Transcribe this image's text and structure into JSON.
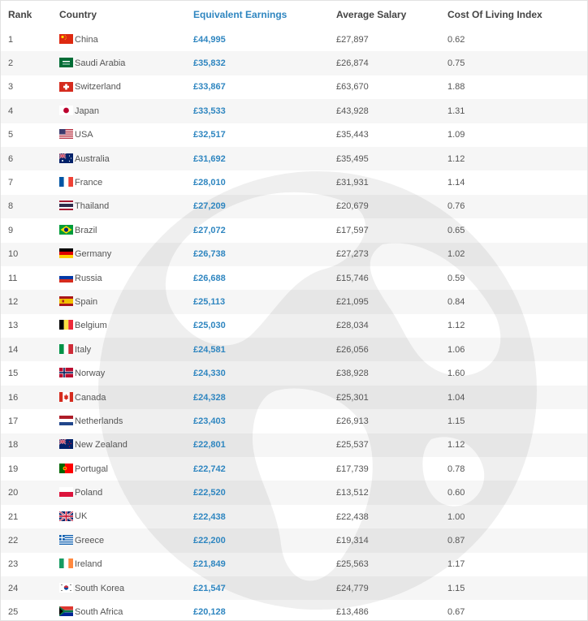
{
  "columns": {
    "rank": "Rank",
    "country": "Country",
    "equivalent_earnings": "Equivalent Earnings",
    "average_salary": "Average Salary",
    "cost_of_living_index": "Cost Of Living Index"
  },
  "accent_color": "#2f86c0",
  "rows": [
    {
      "rank": "1",
      "country": "China",
      "flag": "flag-china-icon",
      "earnings": "£44,995",
      "salary": "£27,897",
      "index": "0.62"
    },
    {
      "rank": "2",
      "country": "Saudi Arabia",
      "flag": "flag-saudi-arabia-icon",
      "earnings": "£35,832",
      "salary": "£26,874",
      "index": "0.75"
    },
    {
      "rank": "3",
      "country": "Switzerland",
      "flag": "flag-switzerland-icon",
      "earnings": "£33,867",
      "salary": "£63,670",
      "index": "1.88"
    },
    {
      "rank": "4",
      "country": "Japan",
      "flag": "flag-japan-icon",
      "earnings": "£33,533",
      "salary": "£43,928",
      "index": "1.31"
    },
    {
      "rank": "5",
      "country": "USA",
      "flag": "flag-usa-icon",
      "earnings": "£32,517",
      "salary": "£35,443",
      "index": "1.09"
    },
    {
      "rank": "6",
      "country": "Australia",
      "flag": "flag-australia-icon",
      "earnings": "£31,692",
      "salary": "£35,495",
      "index": "1.12"
    },
    {
      "rank": "7",
      "country": "France",
      "flag": "flag-france-icon",
      "earnings": "£28,010",
      "salary": "£31,931",
      "index": "1.14"
    },
    {
      "rank": "8",
      "country": "Thailand",
      "flag": "flag-thailand-icon",
      "earnings": "£27,209",
      "salary": "£20,679",
      "index": "0.76"
    },
    {
      "rank": "9",
      "country": "Brazil",
      "flag": "flag-brazil-icon",
      "earnings": "£27,072",
      "salary": "£17,597",
      "index": "0.65"
    },
    {
      "rank": "10",
      "country": "Germany",
      "flag": "flag-germany-icon",
      "earnings": "£26,738",
      "salary": "£27,273",
      "index": "1.02"
    },
    {
      "rank": "11",
      "country": "Russia",
      "flag": "flag-russia-icon",
      "earnings": "£26,688",
      "salary": "£15,746",
      "index": "0.59"
    },
    {
      "rank": "12",
      "country": "Spain",
      "flag": "flag-spain-icon",
      "earnings": "£25,113",
      "salary": "£21,095",
      "index": "0.84"
    },
    {
      "rank": "13",
      "country": "Belgium",
      "flag": "flag-belgium-icon",
      "earnings": "£25,030",
      "salary": "£28,034",
      "index": "1.12"
    },
    {
      "rank": "14",
      "country": "Italy",
      "flag": "flag-italy-icon",
      "earnings": "£24,581",
      "salary": "£26,056",
      "index": "1.06"
    },
    {
      "rank": "15",
      "country": "Norway",
      "flag": "flag-norway-icon",
      "earnings": "£24,330",
      "salary": "£38,928",
      "index": "1.60"
    },
    {
      "rank": "16",
      "country": "Canada",
      "flag": "flag-canada-icon",
      "earnings": "£24,328",
      "salary": "£25,301",
      "index": "1.04"
    },
    {
      "rank": "17",
      "country": "Netherlands",
      "flag": "flag-netherlands-icon",
      "earnings": "£23,403",
      "salary": "£26,913",
      "index": "1.15"
    },
    {
      "rank": "18",
      "country": "New Zealand",
      "flag": "flag-new-zealand-icon",
      "earnings": "£22,801",
      "salary": "£25,537",
      "index": "1.12"
    },
    {
      "rank": "19",
      "country": "Portugal",
      "flag": "flag-portugal-icon",
      "earnings": "£22,742",
      "salary": "£17,739",
      "index": "0.78"
    },
    {
      "rank": "20",
      "country": "Poland",
      "flag": "flag-poland-icon",
      "earnings": "£22,520",
      "salary": "£13,512",
      "index": "0.60"
    },
    {
      "rank": "21",
      "country": "UK",
      "flag": "flag-uk-icon",
      "earnings": "£22,438",
      "salary": "£22,438",
      "index": "1.00"
    },
    {
      "rank": "22",
      "country": "Greece",
      "flag": "flag-greece-icon",
      "earnings": "£22,200",
      "salary": "£19,314",
      "index": "0.87"
    },
    {
      "rank": "23",
      "country": "Ireland",
      "flag": "flag-ireland-icon",
      "earnings": "£21,849",
      "salary": "£25,563",
      "index": "1.17"
    },
    {
      "rank": "24",
      "country": "South Korea",
      "flag": "flag-south-korea-icon",
      "earnings": "£21,547",
      "salary": "£24,779",
      "index": "1.15"
    },
    {
      "rank": "25",
      "country": "South Africa",
      "flag": "flag-south-africa-icon",
      "earnings": "£20,128",
      "salary": "£13,486",
      "index": "0.67"
    }
  ]
}
